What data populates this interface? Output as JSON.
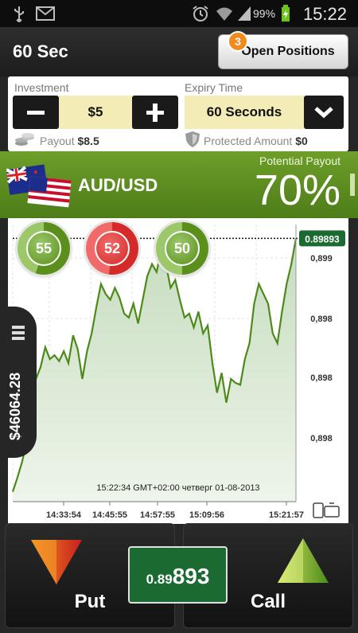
{
  "status_bar": {
    "icons": [
      "usb-icon",
      "gmail-icon",
      "alarm-icon",
      "wifi-icon",
      "signal-icon",
      "battery-charging-icon"
    ],
    "battery": "99%",
    "time": "15:22"
  },
  "header": {
    "title": "60 Sec",
    "open_positions_label": "Open Positions",
    "open_positions_count": "3"
  },
  "trade_panel": {
    "investment_label": "Investment",
    "investment_value": "$5",
    "expiry_label": "Expiry Time",
    "expiry_value": "60 Seconds",
    "payout_label": "Payout",
    "payout_value": "$8.5",
    "protected_label": "Protected Amount",
    "protected_value": "$0"
  },
  "asset": {
    "name": "AUD/USD",
    "potential_payout_label": "Potential Payout",
    "potential_payout_value": "70%"
  },
  "sentiment_gauges": [
    {
      "value": "55",
      "color": "#5a8f1c",
      "level": 0.55
    },
    {
      "value": "52",
      "color": "#d42a2a",
      "level": 0.52
    },
    {
      "value": "50",
      "color": "#5a8f1c",
      "level": 0.5
    }
  ],
  "side_panel": {
    "balance": "$46064.28"
  },
  "chart_data": {
    "type": "area",
    "current_price_label": "0.89893",
    "y_tick_labels": [
      "0,899",
      "0,898",
      "0,898",
      "0,898"
    ],
    "x_tick_labels": [
      "14:33:54",
      "14:45:55",
      "14:57:55",
      "15:09:56",
      "15:21:57"
    ],
    "timestamp_label": "15:22:34  GMT+02:00  четверг  01-08-2013",
    "ylim": [
      0.8976,
      0.899
    ],
    "series": [
      {
        "values": [
          0.89765,
          0.89772,
          0.8978,
          0.8979,
          0.8981,
          0.89822,
          0.89828,
          0.89838,
          0.89832,
          0.89834,
          0.89831,
          0.89836,
          0.8983,
          0.89844,
          0.89837,
          0.89822,
          0.89836,
          0.89845,
          0.89858,
          0.8987,
          0.89865,
          0.89862,
          0.89868,
          0.89863,
          0.89855,
          0.89853,
          0.8986,
          0.8985,
          0.89862,
          0.89874,
          0.8988,
          0.89876,
          0.89888,
          0.8988,
          0.89868,
          0.89872,
          0.89862,
          0.89853,
          0.89855,
          0.89848,
          0.89856,
          0.89845,
          0.89849,
          0.8983,
          0.89815,
          0.89825,
          0.8981,
          0.89822,
          0.8982,
          0.89819,
          0.89832,
          0.8984,
          0.8986,
          0.8987,
          0.89865,
          0.8986,
          0.89845,
          0.8984,
          0.89856,
          0.8987,
          0.8988,
          0.89893
        ]
      }
    ],
    "grid": true
  },
  "footer": {
    "put_label": "Put",
    "call_label": "Call",
    "rate_prefix": "0.89",
    "rate_suffix": "893"
  },
  "colors": {
    "accent_green": "#5a8f1c",
    "put_red": "#d83020",
    "call_green": "#7fb02c"
  }
}
